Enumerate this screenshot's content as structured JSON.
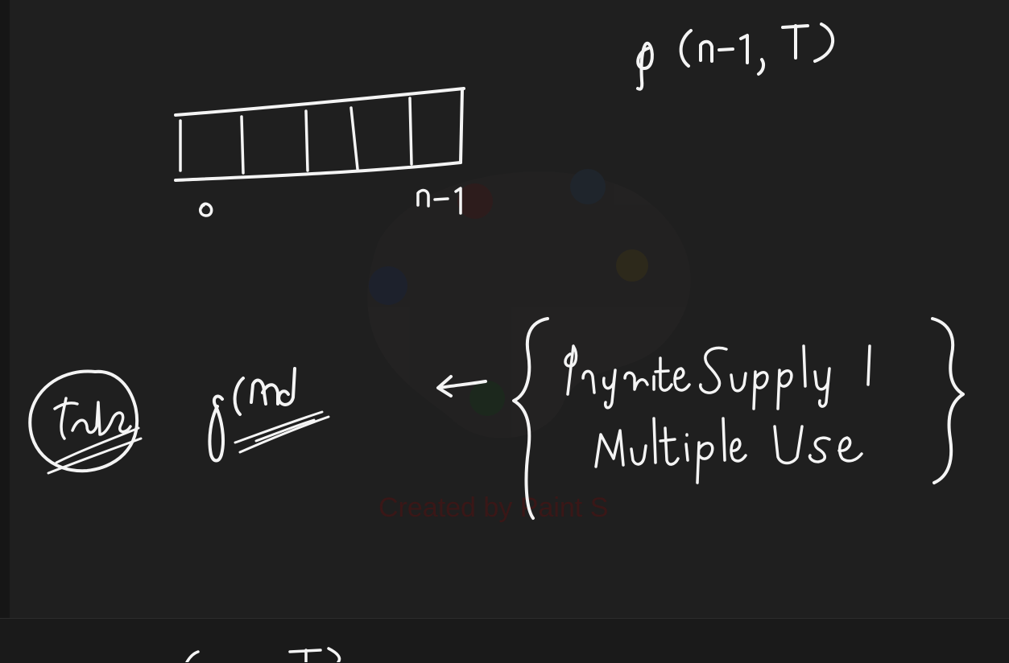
{
  "canvas": {
    "background": "#1f1f1f",
    "ink_color": "#f4f4f4",
    "watermark_color": "#3a1717"
  },
  "watermark": {
    "text": "Created by Paint S",
    "icon": "paint-palette-icon"
  },
  "notes": {
    "top_call": "f(n-1, T)",
    "index_start": "0",
    "index_end": "n-1",
    "circled_word": "take",
    "call_name": "f(ind",
    "brace_line_1": "Infinite Supply |",
    "brace_line_2": "Multiple Use",
    "lower_fragment": "T)"
  }
}
